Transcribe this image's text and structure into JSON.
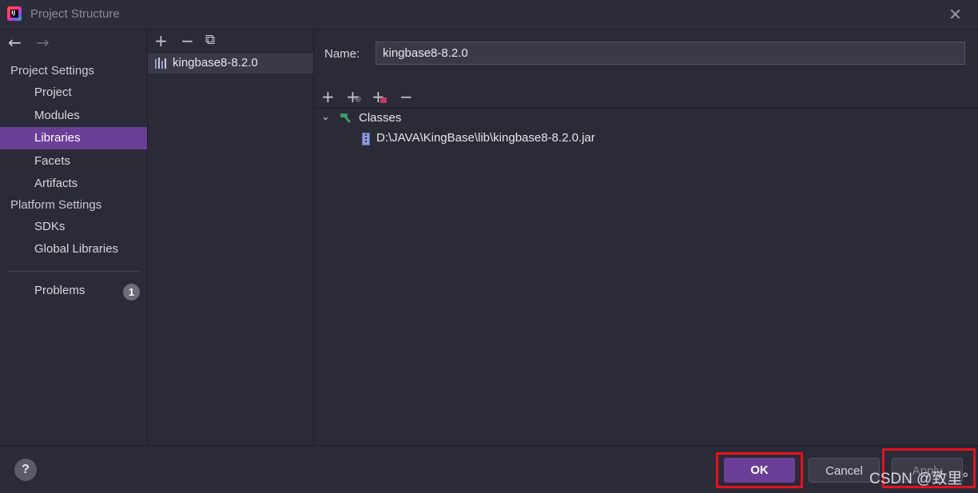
{
  "window": {
    "title": "Project Structure",
    "close_glyph": "✕",
    "app_icon_text": "IJ"
  },
  "nav": {
    "back_glyph": "←",
    "forward_glyph": "→"
  },
  "sidebar": {
    "project_settings_heading": "Project Settings",
    "project_items": [
      {
        "label": "Project"
      },
      {
        "label": "Modules"
      },
      {
        "label": "Libraries",
        "selected": true
      },
      {
        "label": "Facets"
      },
      {
        "label": "Artifacts"
      }
    ],
    "platform_settings_heading": "Platform Settings",
    "platform_items": [
      {
        "label": "SDKs"
      },
      {
        "label": "Global Libraries"
      }
    ],
    "problems": {
      "label": "Problems",
      "count": "1"
    }
  },
  "libraries_panel": {
    "toolbar": {
      "add": "+",
      "remove": "−",
      "copy": "⧉"
    },
    "selected_library": "kingbase8-8.2.0"
  },
  "detail": {
    "name_label": "Name:",
    "name_value": "kingbase8-8.2.0",
    "toolbar": {
      "add": "+",
      "add_alt": "+",
      "add_excluded": "+",
      "remove": "−"
    },
    "tree": {
      "expand_glyph": "⌄",
      "classes_label": "Classes",
      "jar_path": "D:\\JAVA\\KingBase\\lib\\kingbase8-8.2.0.jar"
    }
  },
  "footer": {
    "help_label": "?",
    "ok_label": "OK",
    "cancel_label": "Cancel",
    "apply_label": "Apply",
    "watermark": "CSDN @致里°"
  },
  "colors": {
    "accent": "#6b3f98",
    "background": "#2b2a37",
    "highlight_box": "#e0131f"
  }
}
